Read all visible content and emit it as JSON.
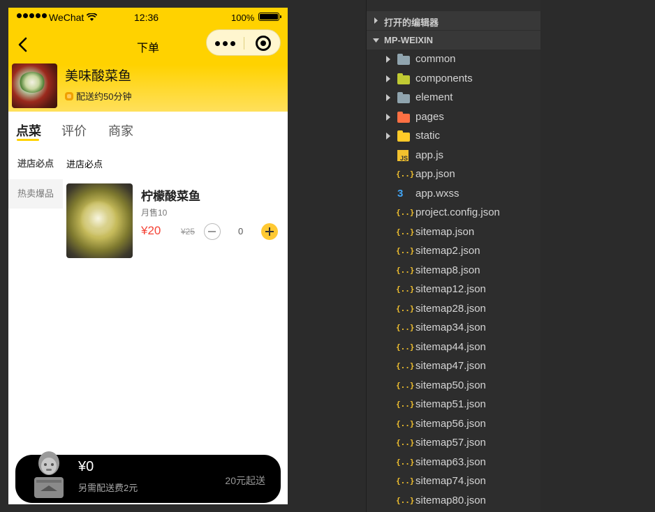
{
  "status_bar": {
    "carrier": "WeChat",
    "time": "12:36",
    "battery": "100%"
  },
  "navbar": {
    "title": "下单"
  },
  "shop": {
    "name": "美味酸菜鱼",
    "delivery": "配送约50分钟"
  },
  "tabs": [
    {
      "label": "点菜",
      "active": true
    },
    {
      "label": "评价",
      "active": false
    },
    {
      "label": "商家",
      "active": false
    }
  ],
  "categories": [
    {
      "label": "进店必点",
      "active": true
    },
    {
      "label": "热卖爆品",
      "active": false
    }
  ],
  "section_title": "进店必点",
  "dish": {
    "name": "柠檬酸菜鱼",
    "sales": "月售10",
    "price": "¥20",
    "original_price": "¥25",
    "quantity": "0"
  },
  "cart": {
    "total": "¥0",
    "fee_note": "另需配送费2元",
    "min_order": "20元起送"
  },
  "explorer": {
    "sections": {
      "open_editors": "打开的编辑器",
      "project": "MP-WEIXIN"
    },
    "items": [
      {
        "name": "common",
        "kind": "folder",
        "icon": "folder-icon",
        "color": "#90a4ae"
      },
      {
        "name": "components",
        "kind": "folder",
        "icon": "components-folder-icon",
        "color": "#c0ca33"
      },
      {
        "name": "element",
        "kind": "folder",
        "icon": "folder-icon",
        "color": "#90a4ae"
      },
      {
        "name": "pages",
        "kind": "folder",
        "icon": "pages-folder-icon",
        "color": "#ff7043"
      },
      {
        "name": "static",
        "kind": "folder",
        "icon": "static-folder-icon",
        "color": "#ffca28"
      },
      {
        "name": "app.js",
        "kind": "js",
        "icon": "js-file-icon",
        "color": "#f2c12e"
      },
      {
        "name": "app.json",
        "kind": "json",
        "icon": "json-file-icon",
        "color": "#f2c12e"
      },
      {
        "name": "app.wxss",
        "kind": "wxss",
        "icon": "css-file-icon",
        "color": "#42a5f5"
      },
      {
        "name": "project.config.json",
        "kind": "json",
        "icon": "json-file-icon",
        "color": "#f2c12e"
      },
      {
        "name": "sitemap.json",
        "kind": "json",
        "icon": "json-file-icon",
        "color": "#f2c12e"
      },
      {
        "name": "sitemap2.json",
        "kind": "json",
        "icon": "json-file-icon",
        "color": "#f2c12e"
      },
      {
        "name": "sitemap8.json",
        "kind": "json",
        "icon": "json-file-icon",
        "color": "#f2c12e"
      },
      {
        "name": "sitemap12.json",
        "kind": "json",
        "icon": "json-file-icon",
        "color": "#f2c12e"
      },
      {
        "name": "sitemap28.json",
        "kind": "json",
        "icon": "json-file-icon",
        "color": "#f2c12e"
      },
      {
        "name": "sitemap34.json",
        "kind": "json",
        "icon": "json-file-icon",
        "color": "#f2c12e"
      },
      {
        "name": "sitemap44.json",
        "kind": "json",
        "icon": "json-file-icon",
        "color": "#f2c12e"
      },
      {
        "name": "sitemap47.json",
        "kind": "json",
        "icon": "json-file-icon",
        "color": "#f2c12e"
      },
      {
        "name": "sitemap50.json",
        "kind": "json",
        "icon": "json-file-icon",
        "color": "#f2c12e"
      },
      {
        "name": "sitemap51.json",
        "kind": "json",
        "icon": "json-file-icon",
        "color": "#f2c12e"
      },
      {
        "name": "sitemap56.json",
        "kind": "json",
        "icon": "json-file-icon",
        "color": "#f2c12e"
      },
      {
        "name": "sitemap57.json",
        "kind": "json",
        "icon": "json-file-icon",
        "color": "#f2c12e"
      },
      {
        "name": "sitemap63.json",
        "kind": "json",
        "icon": "json-file-icon",
        "color": "#f2c12e"
      },
      {
        "name": "sitemap74.json",
        "kind": "json",
        "icon": "json-file-icon",
        "color": "#f2c12e"
      },
      {
        "name": "sitemap80.json",
        "kind": "json",
        "icon": "json-file-icon",
        "color": "#f2c12e"
      }
    ]
  },
  "colors": {
    "brand_yellow": "#ffd200",
    "price_red": "#f44336",
    "ide_background": "#2d2d2d"
  }
}
